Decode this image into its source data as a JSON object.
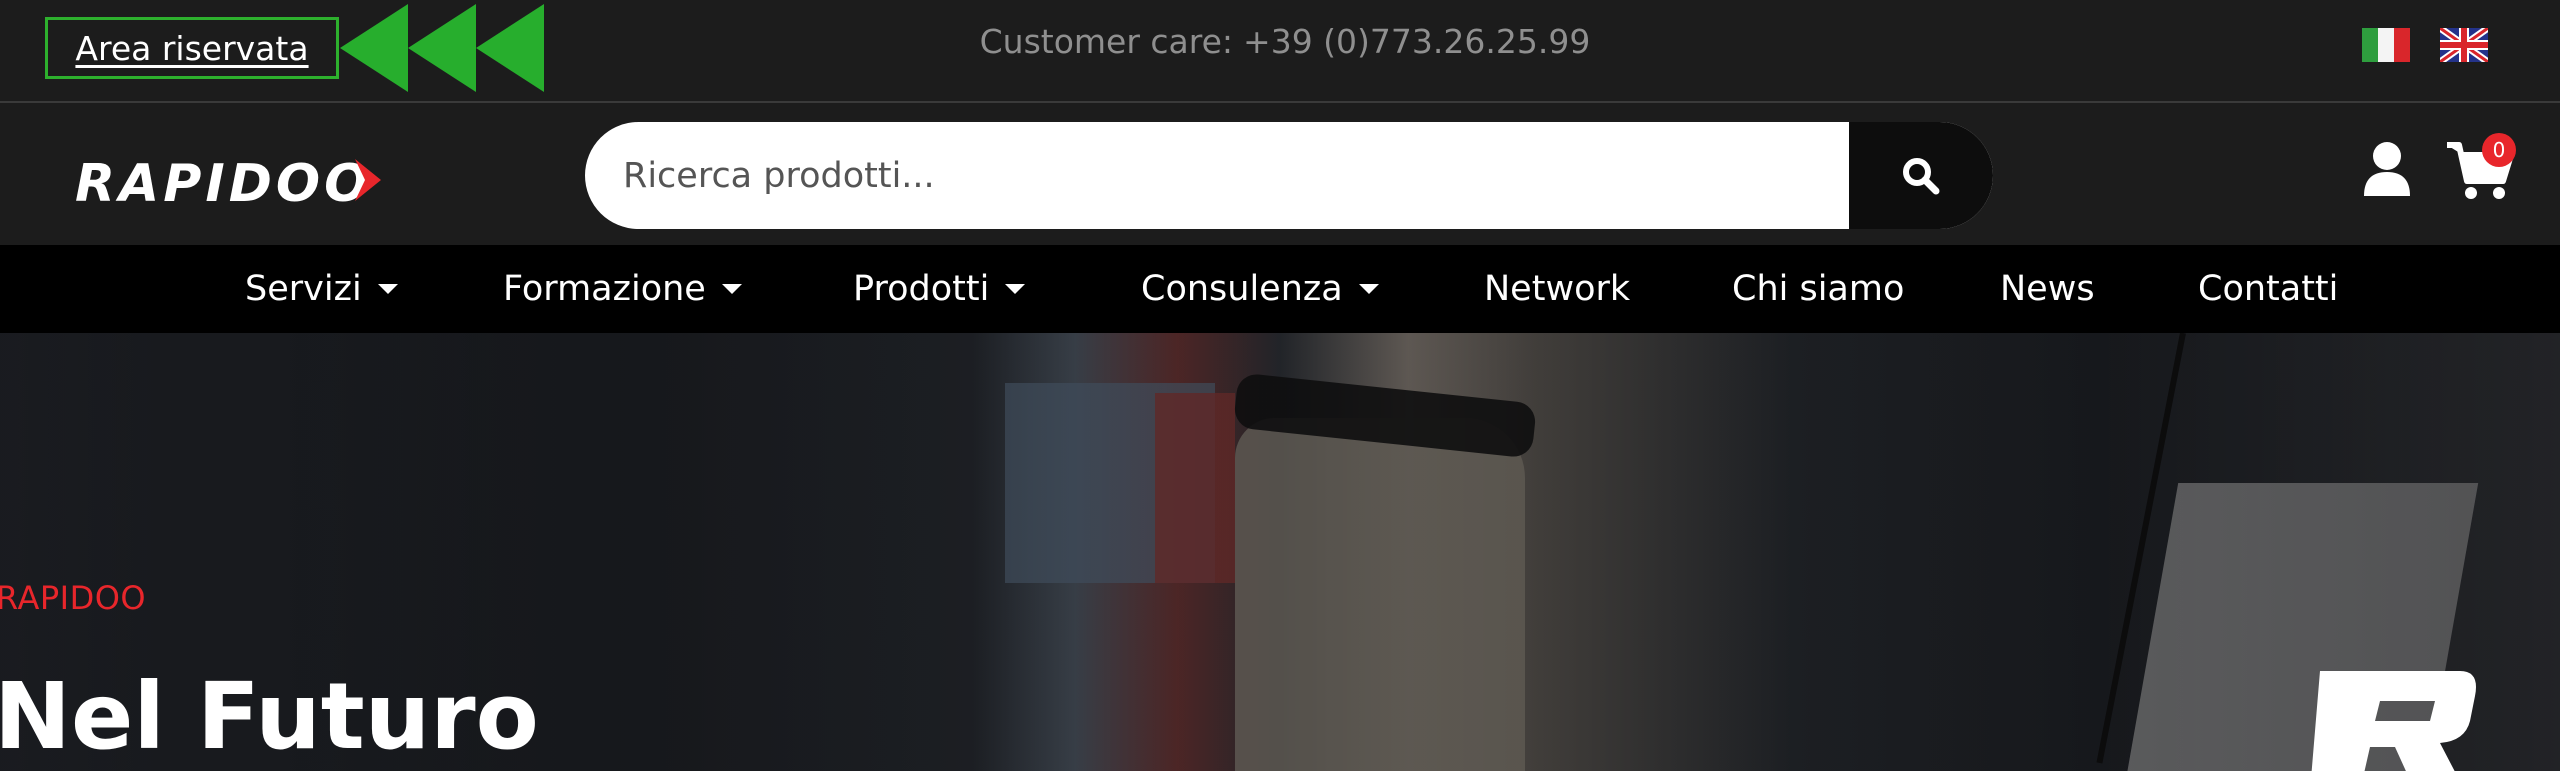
{
  "topbar": {
    "area_link": "Area riservata",
    "customer_care_label": "Customer care:",
    "customer_care_phone": "+39 (0)773.26.25.99",
    "languages": [
      "it-flag-icon",
      "uk-flag-icon"
    ],
    "arrow_color": "#2db02d"
  },
  "header": {
    "logo_text": "RAPIDOO",
    "search": {
      "placeholder": "Ricerca prodotti..."
    },
    "cart_count": "0"
  },
  "nav": {
    "items": [
      {
        "label": "Servizi",
        "dropdown": true
      },
      {
        "label": "Formazione",
        "dropdown": true
      },
      {
        "label": "Prodotti",
        "dropdown": true
      },
      {
        "label": "Consulenza",
        "dropdown": true
      },
      {
        "label": "Network",
        "dropdown": false
      },
      {
        "label": "Chi siamo",
        "dropdown": false
      },
      {
        "label": "News",
        "dropdown": false
      },
      {
        "label": "Contatti",
        "dropdown": false
      }
    ]
  },
  "hero": {
    "eyebrow": "RAPIDOO",
    "title": "Nel Futuro"
  },
  "colors": {
    "brand_red": "#e8262b",
    "nav_bg": "#000000",
    "header_bg": "#1c1c1c"
  }
}
